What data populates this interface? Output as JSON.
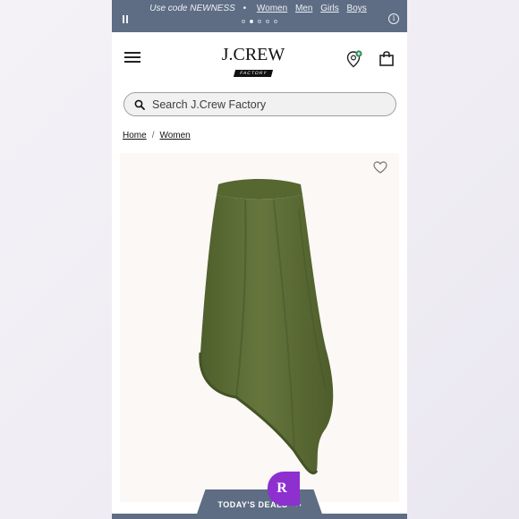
{
  "promo": {
    "code_text": "Use code NEWNESS",
    "separator": "•",
    "links": [
      "Women",
      "Men",
      "Girls",
      "Boys"
    ],
    "carousel_dots": 5,
    "active_dot": 1
  },
  "header": {
    "logo_main": "J.CREW",
    "logo_sub": "FACTORY"
  },
  "search": {
    "placeholder": "Search J.Crew Factory"
  },
  "breadcrumb": {
    "items": [
      "Home",
      "Women"
    ],
    "separator": "/"
  },
  "product": {
    "image_color": "#5b6b34"
  },
  "rewards": {
    "badge_letter": "R"
  },
  "deals": {
    "label": "TODAY'S DEALS"
  },
  "colors": {
    "promo_bar": "#5e6d84",
    "accent_purple": "#8e2fd0",
    "product_green": "#5b6b34"
  }
}
